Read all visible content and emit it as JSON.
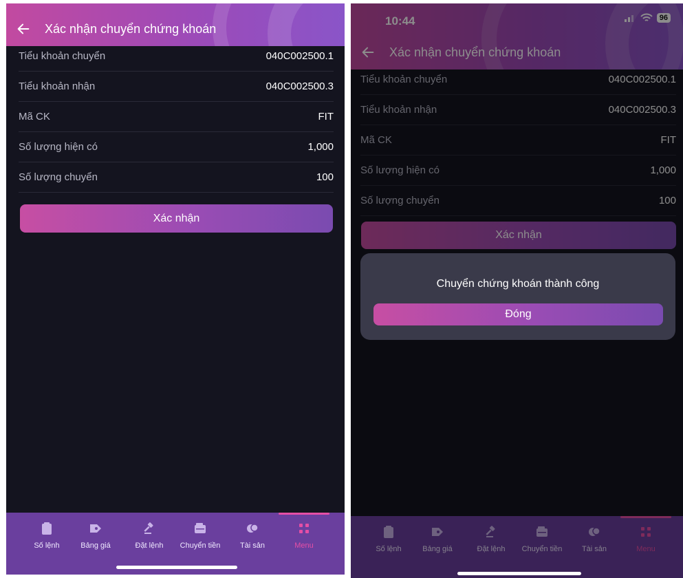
{
  "left": {
    "title": "Xác nhận chuyển chứng khoán",
    "rows": [
      {
        "label": "Tiểu khoản chuyển",
        "value": "040C002500.1"
      },
      {
        "label": "Tiểu khoản nhận",
        "value": "040C002500.3"
      },
      {
        "label": "Mã CK",
        "value": "FIT"
      },
      {
        "label": "Số lượng hiện có",
        "value": "1,000"
      },
      {
        "label": "Số lượng chuyển",
        "value": "100"
      }
    ],
    "confirm_label": "Xác nhận"
  },
  "right": {
    "status_time": "10:44",
    "battery": "96",
    "title": "Xác nhận chuyển chứng khoán",
    "rows": [
      {
        "label": "Tiểu khoản chuyển",
        "value": "040C002500.1"
      },
      {
        "label": "Tiểu khoản nhận",
        "value": "040C002500.3"
      },
      {
        "label": "Mã CK",
        "value": "FIT"
      },
      {
        "label": "Số lượng hiện có",
        "value": "1,000"
      },
      {
        "label": "Số lượng chuyển",
        "value": "100"
      }
    ],
    "confirm_label": "Xác nhận",
    "dialog": {
      "message": "Chuyển chứng khoán thành công",
      "close_label": "Đóng"
    }
  },
  "tabs": [
    {
      "label": "Số lệnh",
      "icon": "clipboard-icon"
    },
    {
      "label": "Bảng giá",
      "icon": "price-tag-icon"
    },
    {
      "label": "Đặt lệnh",
      "icon": "gavel-icon"
    },
    {
      "label": "Chuyển tiền",
      "icon": "wallet-icon"
    },
    {
      "label": "Tài sản",
      "icon": "coins-icon"
    },
    {
      "label": "Menu",
      "icon": "grid-icon"
    }
  ],
  "colors": {
    "accent": "#e54fa6",
    "tabbar": "#6a3f9e",
    "background": "#14141f"
  }
}
